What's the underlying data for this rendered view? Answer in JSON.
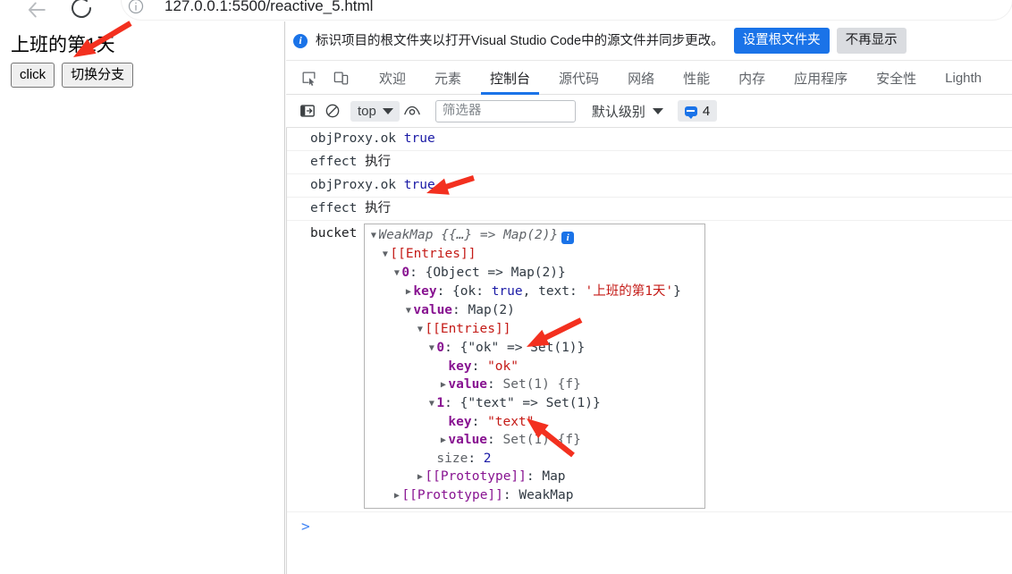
{
  "browser": {
    "back_icon": "back-arrow-icon",
    "reload_icon": "reload-icon",
    "site_info_icon": "info-circle-icon",
    "url": "127.0.0.1:5500/reactive_5.html"
  },
  "page": {
    "heading": "上班的第1天",
    "buttons": [
      {
        "label": "click",
        "name": "click-button"
      },
      {
        "label": "切换分支",
        "name": "switch-branch-button"
      }
    ]
  },
  "devtools": {
    "banner": {
      "icon": "info-circle-icon",
      "text": "标识项目的根文件夹以打开Visual Studio Code中的源文件并同步更改。",
      "primary_button": "设置根文件夹",
      "secondary_button": "不再显示"
    },
    "tool_icons": [
      {
        "name": "inspect-element-icon"
      },
      {
        "name": "device-toolbar-icon"
      }
    ],
    "tabs": [
      {
        "label": "欢迎",
        "active": false
      },
      {
        "label": "元素",
        "active": false
      },
      {
        "label": "控制台",
        "active": true
      },
      {
        "label": "源代码",
        "active": false
      },
      {
        "label": "网络",
        "active": false
      },
      {
        "label": "性能",
        "active": false
      },
      {
        "label": "内存",
        "active": false
      },
      {
        "label": "应用程序",
        "active": false
      },
      {
        "label": "安全性",
        "active": false
      },
      {
        "label": "Lighth",
        "active": false
      }
    ],
    "console_toolbar": {
      "sidebar_icon": "console-sidebar-icon",
      "clear_icon": "clear-console-icon",
      "context": "top",
      "eye_icon": "live-expression-eye-icon",
      "filter_placeholder": "筛选器",
      "filter_value": "",
      "level": "默认级别",
      "message_badge_icon": "message-bubble-icon",
      "message_count": "4"
    },
    "logs": [
      {
        "type": "text",
        "parts": [
          {
            "t": "objProxy.ok ",
            "k": "plain"
          },
          {
            "t": "true",
            "k": "bool"
          }
        ]
      },
      {
        "type": "text",
        "parts": [
          {
            "t": "effect ",
            "k": "plain"
          },
          {
            "t": "执行",
            "k": "cn"
          }
        ]
      },
      {
        "type": "text",
        "parts": [
          {
            "t": "objProxy.ok ",
            "k": "plain"
          },
          {
            "t": "true",
            "k": "bool"
          }
        ]
      },
      {
        "type": "text",
        "parts": [
          {
            "t": "effect ",
            "k": "plain"
          },
          {
            "t": "执行",
            "k": "cn"
          }
        ]
      }
    ],
    "object_log": {
      "label": "bucket",
      "tree": [
        {
          "indent": 0,
          "tri": "open",
          "segs": [
            {
              "t": "WeakMap {{…} => Map(2)}",
              "k": "header"
            },
            {
              "t": "INFO_CHIP",
              "k": "chip"
            }
          ]
        },
        {
          "indent": 1,
          "tri": "open",
          "segs": [
            {
              "t": "[[Entries]]",
              "k": "entries"
            }
          ]
        },
        {
          "indent": 2,
          "tri": "open",
          "segs": [
            {
              "t": "0",
              "k": "idx"
            },
            {
              "t": ": {Object => Map(2)}",
              "k": "plain"
            }
          ]
        },
        {
          "indent": 3,
          "tri": "closed",
          "segs": [
            {
              "t": "key",
              "k": "key"
            },
            {
              "t": ": {ok: ",
              "k": "plain"
            },
            {
              "t": "true",
              "k": "bool"
            },
            {
              "t": ", text: ",
              "k": "plain"
            },
            {
              "t": "'上班的第1天'",
              "k": "str"
            },
            {
              "t": "}",
              "k": "plain"
            }
          ]
        },
        {
          "indent": 3,
          "tri": "open",
          "segs": [
            {
              "t": "value",
              "k": "key"
            },
            {
              "t": ": Map(2)",
              "k": "plain"
            }
          ]
        },
        {
          "indent": 4,
          "tri": "open",
          "segs": [
            {
              "t": "[[Entries]]",
              "k": "entries"
            }
          ]
        },
        {
          "indent": 5,
          "tri": "open",
          "segs": [
            {
              "t": "0",
              "k": "idx"
            },
            {
              "t": ": {\"ok\" => Set(1)}",
              "k": "plain"
            }
          ]
        },
        {
          "indent": 6,
          "tri": "blank",
          "segs": [
            {
              "t": "key",
              "k": "key"
            },
            {
              "t": ": ",
              "k": "plain"
            },
            {
              "t": "\"ok\"",
              "k": "str"
            }
          ]
        },
        {
          "indent": 6,
          "tri": "closed",
          "segs": [
            {
              "t": "value",
              "k": "key"
            },
            {
              "t": ": ",
              "k": "plain"
            },
            {
              "t": "Set(1) {f}",
              "k": "gray"
            }
          ]
        },
        {
          "indent": 5,
          "tri": "open",
          "segs": [
            {
              "t": "1",
              "k": "idx"
            },
            {
              "t": ": {\"text\" => Set(1)}",
              "k": "plain"
            }
          ]
        },
        {
          "indent": 6,
          "tri": "blank",
          "segs": [
            {
              "t": "key",
              "k": "key"
            },
            {
              "t": ": ",
              "k": "plain"
            },
            {
              "t": "\"text\"",
              "k": "str"
            }
          ]
        },
        {
          "indent": 6,
          "tri": "closed",
          "segs": [
            {
              "t": "value",
              "k": "key"
            },
            {
              "t": ": ",
              "k": "plain"
            },
            {
              "t": "Set(1) {f}",
              "k": "gray"
            }
          ]
        },
        {
          "indent": 5,
          "tri": "blank",
          "segs": [
            {
              "t": "size",
              "k": "gray"
            },
            {
              "t": ": ",
              "k": "plain"
            },
            {
              "t": "2",
              "k": "num"
            }
          ]
        },
        {
          "indent": 4,
          "tri": "closed",
          "segs": [
            {
              "t": "[[Prototype]]",
              "k": "proto"
            },
            {
              "t": ": Map",
              "k": "plain"
            }
          ]
        },
        {
          "indent": 2,
          "tri": "closed",
          "segs": [
            {
              "t": "[[Prototype]]",
              "k": "proto"
            },
            {
              "t": ": WeakMap",
              "k": "plain"
            }
          ]
        }
      ]
    },
    "prompt": ">"
  },
  "annotations": {
    "arrow_color": "#f3301f",
    "arrows": [
      {
        "name": "arrow-to-page-heading"
      },
      {
        "name": "arrow-to-console-true"
      },
      {
        "name": "arrow-to-ok-entry"
      },
      {
        "name": "arrow-to-text-key"
      }
    ]
  }
}
